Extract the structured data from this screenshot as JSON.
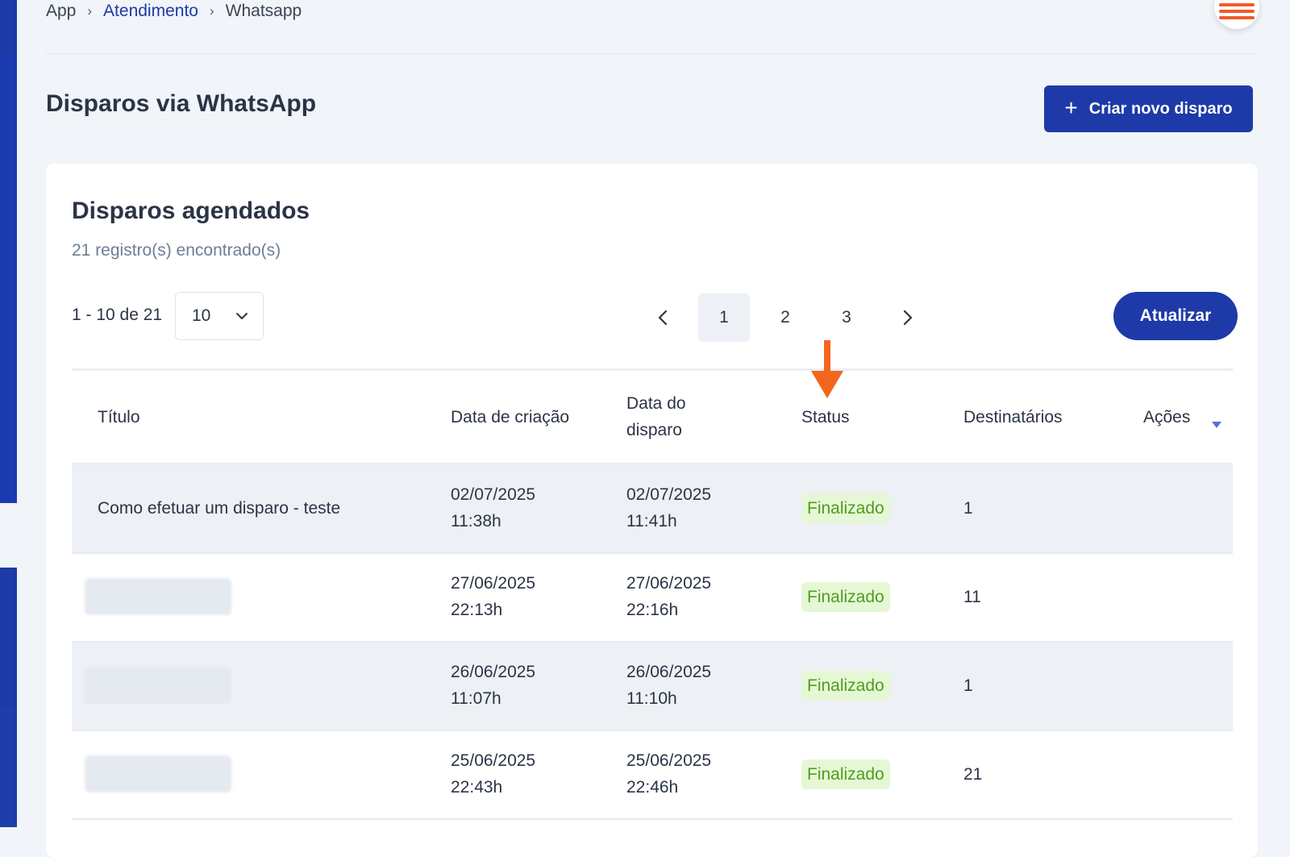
{
  "breadcrumb": {
    "root": "App",
    "section": "Atendimento",
    "current": "Whatsapp"
  },
  "page": {
    "title": "Disparos via WhatsApp",
    "new_button": "Criar novo disparo"
  },
  "card": {
    "title": "Disparos agendados",
    "subtitle": "21 registro(s) encontrado(s)"
  },
  "pagination": {
    "range": "1 - 10 de 21",
    "page_size": "10",
    "pages": [
      "1",
      "2",
      "3"
    ],
    "current_page": "1",
    "refresh_button": "Atualizar"
  },
  "table": {
    "headers": {
      "title": "Título",
      "created": "Data de criação",
      "sent": "Data do disparo",
      "status": "Status",
      "recipients": "Destinatários",
      "actions": "Ações"
    },
    "rows": [
      {
        "title": "Como efetuar um disparo - teste",
        "created_date": "02/07/2025",
        "created_time": "11:38h",
        "sent_date": "02/07/2025",
        "sent_time": "11:41h",
        "status": "Finalizado",
        "recipients": "1"
      },
      {
        "title": "",
        "created_date": "27/06/2025",
        "created_time": "22:13h",
        "sent_date": "27/06/2025",
        "sent_time": "22:16h",
        "status": "Finalizado",
        "recipients": "11"
      },
      {
        "title": "",
        "created_date": "26/06/2025",
        "created_time": "11:07h",
        "sent_date": "26/06/2025",
        "sent_time": "11:10h",
        "status": "Finalizado",
        "recipients": "1"
      },
      {
        "title": "",
        "created_date": "25/06/2025",
        "created_time": "22:43h",
        "sent_date": "25/06/2025",
        "sent_time": "22:46h",
        "status": "Finalizado",
        "recipients": "21"
      }
    ]
  },
  "colors": {
    "brand": "#1e3aa8",
    "annotation": "#f2661c",
    "status_bg": "#e6f7d6",
    "status_text": "#4f9d1c"
  }
}
